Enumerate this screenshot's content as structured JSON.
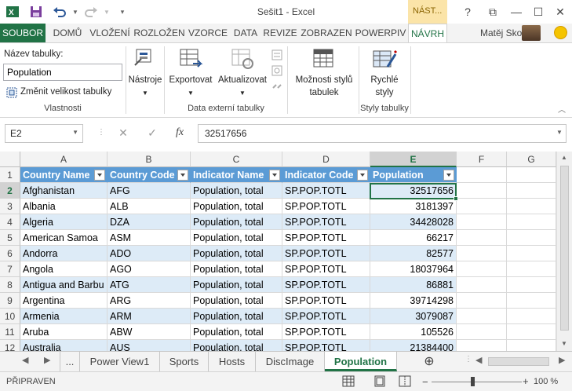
{
  "window": {
    "title": "Sešit1 - Excel",
    "context_tab_group": "NÁST...",
    "controls": {
      "help": "?",
      "restore": "⧉",
      "minimize": "—",
      "maximize": "☐",
      "close": "✕"
    }
  },
  "quick_access": {
    "save_icon": "save-icon",
    "undo_icon": "undo-icon",
    "redo_icon": "redo-icon"
  },
  "ribbon_tabs": [
    "SOUBOR",
    "DOMŮ",
    "VLOŽENÍ",
    "ROZLOŽEN",
    "VZORCE",
    "DATA",
    "REVIZE",
    "ZOBRAZEN",
    "POWERPIV",
    "NÁVRH"
  ],
  "active_ribbon_tab": "NÁVRH",
  "user": {
    "name": "Matěj Sko..."
  },
  "ribbon": {
    "properties": {
      "table_name_label": "Název tabulky:",
      "table_name_value": "Population",
      "resize_label": "Změnit velikost tabulky",
      "group_label": "Vlastnosti"
    },
    "tools": {
      "label": "Nástroje"
    },
    "external": {
      "export_label": "Exportovat",
      "refresh_label": "Aktualizovat",
      "group_label": "Data externí tabulky"
    },
    "style_options": {
      "label_line1": "Možnosti stylů",
      "label_line2": "tabulek"
    },
    "quick_styles": {
      "label_line1": "Rychlé",
      "label_line2": "styly",
      "group_label": "Styly tabulky"
    }
  },
  "formula_bar": {
    "name_box": "E2",
    "cancel": "✕",
    "enter": "✓",
    "fx": "fx",
    "formula": "32517656"
  },
  "grid": {
    "columns": [
      "A",
      "B",
      "C",
      "D",
      "E",
      "F",
      "G"
    ],
    "selected_column": "E",
    "selected_row": "2",
    "header_row": [
      "Country Name",
      "Country Code",
      "Indicator Name",
      "Indicator Code",
      "Population"
    ],
    "rows": [
      {
        "row": "2",
        "name": "Afghanistan",
        "code": "AFG",
        "ind": "Population, total",
        "icode": "SP.POP.TOTL",
        "pop": "32517656"
      },
      {
        "row": "3",
        "name": "Albania",
        "code": "ALB",
        "ind": "Population, total",
        "icode": "SP.POP.TOTL",
        "pop": "3181397"
      },
      {
        "row": "4",
        "name": "Algeria",
        "code": "DZA",
        "ind": "Population, total",
        "icode": "SP.POP.TOTL",
        "pop": "34428028"
      },
      {
        "row": "5",
        "name": "American Samoa",
        "code": "ASM",
        "ind": "Population, total",
        "icode": "SP.POP.TOTL",
        "pop": "66217"
      },
      {
        "row": "6",
        "name": "Andorra",
        "code": "ADO",
        "ind": "Population, total",
        "icode": "SP.POP.TOTL",
        "pop": "82577"
      },
      {
        "row": "7",
        "name": "Angola",
        "code": "AGO",
        "ind": "Population, total",
        "icode": "SP.POP.TOTL",
        "pop": "18037964"
      },
      {
        "row": "8",
        "name": "Antigua and Barbu",
        "code": "ATG",
        "ind": "Population, total",
        "icode": "SP.POP.TOTL",
        "pop": "86881"
      },
      {
        "row": "9",
        "name": "Argentina",
        "code": "ARG",
        "ind": "Population, total",
        "icode": "SP.POP.TOTL",
        "pop": "39714298"
      },
      {
        "row": "10",
        "name": "Armenia",
        "code": "ARM",
        "ind": "Population, total",
        "icode": "SP.POP.TOTL",
        "pop": "3079087"
      },
      {
        "row": "11",
        "name": "Aruba",
        "code": "ABW",
        "ind": "Population, total",
        "icode": "SP.POP.TOTL",
        "pop": "105526"
      },
      {
        "row": "12",
        "name": "Australia",
        "code": "AUS",
        "ind": "Population, total",
        "icode": "SP.POP.TOTL",
        "pop": "21384400"
      }
    ]
  },
  "sheets": {
    "ellipsis": "...",
    "tabs": [
      "Power View1",
      "Sports",
      "Hosts",
      "DiscImage",
      "Population"
    ],
    "active": "Population",
    "add_icon": "⊕"
  },
  "status": {
    "text": "PŘIPRAVEN",
    "zoom": "100 %"
  },
  "colors": {
    "accent": "#217346",
    "table_header": "#5b9bd5",
    "band": "#ddebf7",
    "context": "#fbe4a8"
  }
}
